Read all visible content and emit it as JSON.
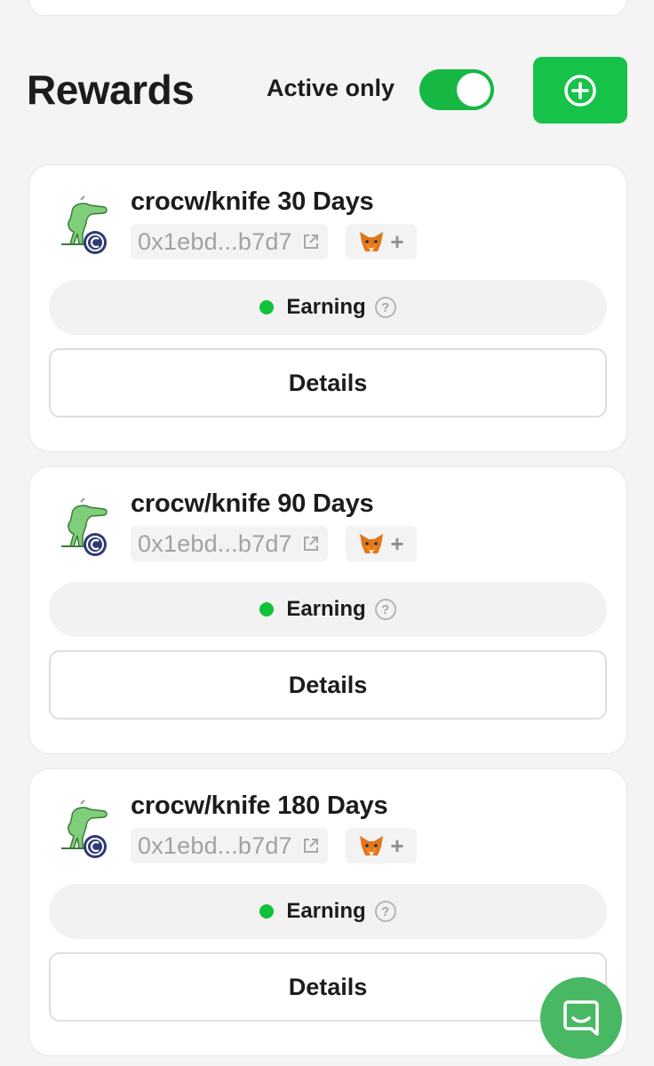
{
  "header": {
    "title": "Rewards",
    "toggle_label": "Active only",
    "toggle_on": true
  },
  "colors": {
    "accent_green": "#16c248",
    "status_green": "#10c23a",
    "chat_green": "#49b864"
  },
  "rewards": [
    {
      "name": "crocw/knife 30 Days",
      "address": "0x1ebd...b7d7",
      "status": "Earning",
      "details_label": "Details",
      "icons": [
        "croc-token-icon",
        "external-link-icon",
        "metamask-fox-icon",
        "plus-icon",
        "help-icon"
      ]
    },
    {
      "name": "crocw/knife 90 Days",
      "address": "0x1ebd...b7d7",
      "status": "Earning",
      "details_label": "Details",
      "icons": [
        "croc-token-icon",
        "external-link-icon",
        "metamask-fox-icon",
        "plus-icon",
        "help-icon"
      ]
    },
    {
      "name": "crocw/knife 180 Days",
      "address": "0x1ebd...b7d7",
      "status": "Earning",
      "details_label": "Details",
      "icons": [
        "croc-token-icon",
        "external-link-icon",
        "metamask-fox-icon",
        "plus-icon",
        "help-icon"
      ]
    }
  ],
  "wallet_plus": "+",
  "help_glyph": "?",
  "chat_icon": "chat-bubble-icon"
}
